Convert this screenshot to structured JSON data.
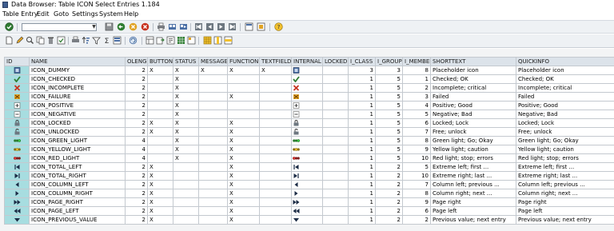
{
  "window": {
    "title": "Data Browser: Table ICON Select Entries         1.184"
  },
  "menu": [
    "Table Entry",
    "Edit",
    "Goto",
    "Settings",
    "System",
    "Help"
  ],
  "toolbar1": {
    "icons": [
      "enter-icon",
      "save-icon",
      "back-icon",
      "exit-icon",
      "cancel-icon",
      "print-icon",
      "find-icon",
      "find-next-icon",
      "first-page-icon",
      "previous-page-icon",
      "next-page-icon",
      "last-page-icon",
      "new-session-icon",
      "shortcut-icon",
      "help-icon"
    ]
  },
  "toolbar2": {
    "icons": [
      "new-entry-icon",
      "edit-icon",
      "display-icon",
      "copy-icon",
      "delete-icon",
      "check-icon",
      "print-icon",
      "sort-ascending-icon",
      "filter-icon",
      "sum-icon",
      "select-all-icon",
      "deselect-icon",
      "refresh-icon",
      "layout-icon",
      "export-icon",
      "detail-icon",
      "spreadsheet-icon",
      "table-settings-icon",
      "column-icon"
    ]
  },
  "grid": {
    "columns": [
      "ID",
      "NAME",
      "OLENG",
      "BUTTON",
      "STATUS",
      "MESSAGE",
      "FUNCTION",
      "TEXTFIELD",
      "INTERNAL",
      "LOCKED",
      "I_CLASS",
      "I_GROUP",
      "I_MEMBER",
      "SHORTTEXT",
      "QUICKINFO"
    ],
    "rows": [
      {
        "id_icon": "dummy",
        "name": "ICON_DUMMY",
        "oleng": "2",
        "button": "X",
        "status": "X",
        "message": "X",
        "function": "X",
        "textfield": "X",
        "internal_icon": "dummy",
        "locked": "",
        "i_class": "3",
        "i_group": "3",
        "i_member": "8",
        "shorttext": "Placeholder icon",
        "quickinfo": "Placeholder icon"
      },
      {
        "id_icon": "checked",
        "name": "ICON_CHECKED",
        "oleng": "2",
        "button": "",
        "status": "X",
        "message": "",
        "function": "",
        "textfield": "",
        "internal_icon": "checked",
        "locked": "",
        "i_class": "1",
        "i_group": "5",
        "i_member": "1",
        "shorttext": "Checked; OK",
        "quickinfo": "Checked; OK"
      },
      {
        "id_icon": "incomplete",
        "name": "ICON_INCOMPLETE",
        "oleng": "2",
        "button": "",
        "status": "X",
        "message": "",
        "function": "",
        "textfield": "",
        "internal_icon": "incomplete",
        "locked": "",
        "i_class": "1",
        "i_group": "5",
        "i_member": "2",
        "shorttext": "Incomplete; critical",
        "quickinfo": "Incomplete; critical"
      },
      {
        "id_icon": "failure",
        "name": "ICON_FAILURE",
        "oleng": "2",
        "button": "",
        "status": "X",
        "message": "",
        "function": "X",
        "textfield": "",
        "internal_icon": "failure",
        "locked": "",
        "i_class": "1",
        "i_group": "5",
        "i_member": "3",
        "shorttext": "Failed",
        "quickinfo": "Failed"
      },
      {
        "id_icon": "positive",
        "name": "ICON_POSITIVE",
        "oleng": "2",
        "button": "",
        "status": "X",
        "message": "",
        "function": "",
        "textfield": "",
        "internal_icon": "positive",
        "locked": "",
        "i_class": "1",
        "i_group": "5",
        "i_member": "4",
        "shorttext": "Positive; Good",
        "quickinfo": "Positive; Good"
      },
      {
        "id_icon": "negative",
        "name": "ICON_NEGATIVE",
        "oleng": "2",
        "button": "",
        "status": "X",
        "message": "",
        "function": "",
        "textfield": "",
        "internal_icon": "negative",
        "locked": "",
        "i_class": "1",
        "i_group": "5",
        "i_member": "5",
        "shorttext": "Negative; Bad",
        "quickinfo": "Negative; Bad"
      },
      {
        "id_icon": "locked",
        "name": "ICON_LOCKED",
        "oleng": "2",
        "button": "X",
        "status": "X",
        "message": "",
        "function": "X",
        "textfield": "",
        "internal_icon": "locked",
        "locked": "",
        "i_class": "1",
        "i_group": "5",
        "i_member": "6",
        "shorttext": "Locked; Lock",
        "quickinfo": "Locked; Lock"
      },
      {
        "id_icon": "unlocked",
        "name": "ICON_UNLOCKED",
        "oleng": "2",
        "button": "X",
        "status": "X",
        "message": "",
        "function": "X",
        "textfield": "",
        "internal_icon": "unlocked",
        "locked": "",
        "i_class": "1",
        "i_group": "5",
        "i_member": "7",
        "shorttext": "Free; unlock",
        "quickinfo": "Free; unlock"
      },
      {
        "id_icon": "green-light",
        "name": "ICON_GREEN_LIGHT",
        "oleng": "4",
        "button": "",
        "status": "X",
        "message": "",
        "function": "X",
        "textfield": "",
        "internal_icon": "green-light",
        "locked": "",
        "i_class": "1",
        "i_group": "5",
        "i_member": "8",
        "shorttext": "Green light; Go; Okay",
        "quickinfo": "Green light; Go; Okay"
      },
      {
        "id_icon": "yellow-light",
        "name": "ICON_YELLOW_LIGHT",
        "oleng": "4",
        "button": "",
        "status": "X",
        "message": "",
        "function": "X",
        "textfield": "",
        "internal_icon": "yellow-light",
        "locked": "",
        "i_class": "1",
        "i_group": "5",
        "i_member": "9",
        "shorttext": "Yellow light; caution",
        "quickinfo": "Yellow light; caution"
      },
      {
        "id_icon": "red-light",
        "name": "ICON_RED_LIGHT",
        "oleng": "4",
        "button": "",
        "status": "X",
        "message": "",
        "function": "X",
        "textfield": "",
        "internal_icon": "red-light",
        "locked": "",
        "i_class": "1",
        "i_group": "5",
        "i_member": "10",
        "shorttext": "Red light; stop; errors",
        "quickinfo": "Red light; stop; errors"
      },
      {
        "id_icon": "total-left",
        "name": "ICON_TOTAL_LEFT",
        "oleng": "2",
        "button": "X",
        "status": "",
        "message": "",
        "function": "X",
        "textfield": "",
        "internal_icon": "total-left",
        "locked": "",
        "i_class": "1",
        "i_group": "2",
        "i_member": "5",
        "shorttext": "Extreme left; first ...",
        "quickinfo": "Extreme left; first ..."
      },
      {
        "id_icon": "total-right",
        "name": "ICON_TOTAL_RIGHT",
        "oleng": "2",
        "button": "X",
        "status": "",
        "message": "",
        "function": "X",
        "textfield": "",
        "internal_icon": "total-right",
        "locked": "",
        "i_class": "1",
        "i_group": "2",
        "i_member": "10",
        "shorttext": "Extreme right; last ...",
        "quickinfo": "Extreme right; last ..."
      },
      {
        "id_icon": "column-left",
        "name": "ICON_COLUMN_LEFT",
        "oleng": "2",
        "button": "X",
        "status": "",
        "message": "",
        "function": "X",
        "textfield": "",
        "internal_icon": "column-left",
        "locked": "",
        "i_class": "1",
        "i_group": "2",
        "i_member": "7",
        "shorttext": "Column left; previous ...",
        "quickinfo": "Column left; previous ..."
      },
      {
        "id_icon": "column-right",
        "name": "ICON_COLUMN_RIGHT",
        "oleng": "2",
        "button": "X",
        "status": "",
        "message": "",
        "function": "X",
        "textfield": "",
        "internal_icon": "column-right",
        "locked": "",
        "i_class": "1",
        "i_group": "2",
        "i_member": "8",
        "shorttext": "Column right; next ...",
        "quickinfo": "Column right; next ..."
      },
      {
        "id_icon": "page-right",
        "name": "ICON_PAGE_RIGHT",
        "oleng": "2",
        "button": "X",
        "status": "",
        "message": "",
        "function": "X",
        "textfield": "",
        "internal_icon": "page-right",
        "locked": "",
        "i_class": "1",
        "i_group": "2",
        "i_member": "9",
        "shorttext": "Page right",
        "quickinfo": "Page right"
      },
      {
        "id_icon": "page-left",
        "name": "ICON_PAGE_LEFT",
        "oleng": "2",
        "button": "X",
        "status": "",
        "message": "",
        "function": "X",
        "textfield": "",
        "internal_icon": "page-left",
        "locked": "",
        "i_class": "1",
        "i_group": "2",
        "i_member": "6",
        "shorttext": "Page left",
        "quickinfo": "Page left"
      },
      {
        "id_icon": "previous-value",
        "name": "ICON_PREVIOUS_VALUE",
        "oleng": "2",
        "button": "X",
        "status": "",
        "message": "",
        "function": "X",
        "textfield": "",
        "internal_icon": "previous-value",
        "locked": "",
        "i_class": "1",
        "i_group": "2",
        "i_member": "2",
        "shorttext": "Previous value; next entry",
        "quickinfo": "Previous value; next entry"
      }
    ]
  },
  "colors": {
    "id_cell": "#a7dde0",
    "header": "#dce3ea",
    "toolbar": "#eef1f4"
  }
}
